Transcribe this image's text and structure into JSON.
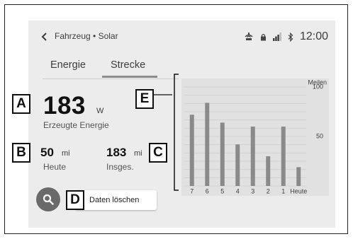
{
  "header": {
    "title": "Fahrzeug • Solar",
    "clock": "12:00",
    "status_icons": [
      "wireless-charging-icon",
      "lock-icon",
      "signal-icon",
      "bluetooth-icon"
    ]
  },
  "tabs": [
    {
      "label": "Energie",
      "selected": false
    },
    {
      "label": "Strecke",
      "selected": true
    }
  ],
  "power": {
    "value": "183",
    "unit": "W",
    "label": "Erzeugte Energie"
  },
  "today": {
    "value": "50",
    "unit": "mi",
    "label": "Heute"
  },
  "total": {
    "value": "183",
    "unit": "mi",
    "label": "Insges."
  },
  "actions": {
    "clear_label": "Daten löschen",
    "search_icon": "search-icon"
  },
  "callouts": {
    "a": "A",
    "b": "B",
    "c": "C",
    "d": "D",
    "e": "E"
  },
  "colors": {
    "bar": "#8a8a8a",
    "screen_bg": "#ececec",
    "chart_bg": "#e1e1e1",
    "button_circle": "#6a6a6a"
  },
  "chart_data": {
    "type": "bar",
    "categories": [
      "7",
      "6",
      "5",
      "4",
      "3",
      "2",
      "1",
      "Heute"
    ],
    "values": [
      72,
      84,
      64,
      42,
      60,
      30,
      60,
      19
    ],
    "ylabel": "Meilen",
    "yticks": [
      50,
      100
    ],
    "ylim": [
      0,
      100
    ],
    "grid": true
  }
}
